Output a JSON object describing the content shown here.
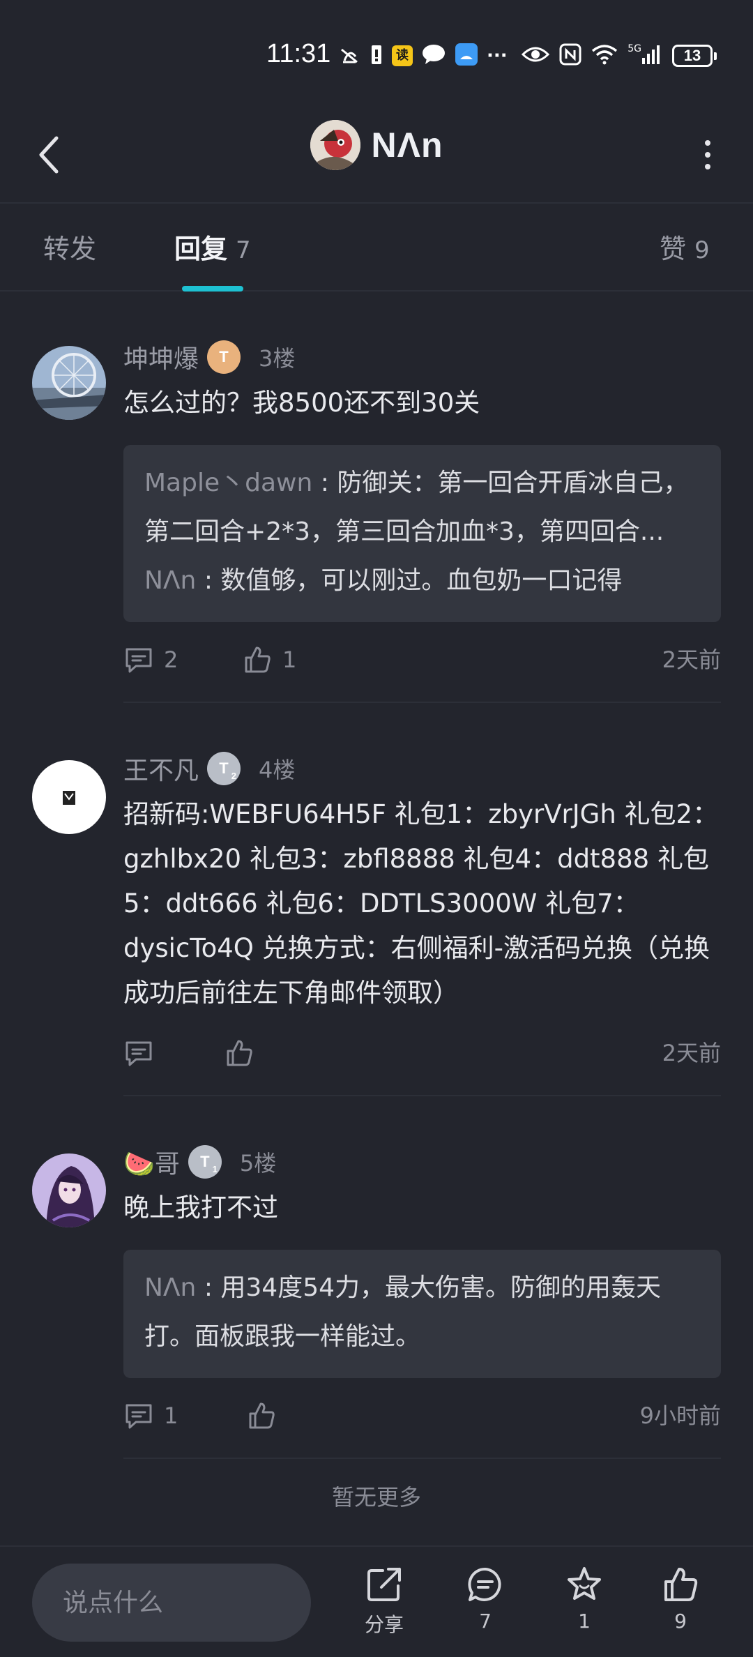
{
  "status_bar": {
    "time": "11:31",
    "badge_read": "读",
    "more_icons": "···",
    "network": "5G",
    "battery": "13"
  },
  "header": {
    "title": "NΛn"
  },
  "tabs": [
    {
      "label": "转发",
      "count": ""
    },
    {
      "label": "回复",
      "count": "7"
    },
    {
      "label": "赞",
      "count": "9"
    }
  ],
  "comments": [
    {
      "user": "坤坤爆",
      "level": "T",
      "floor": "3楼",
      "text": "怎么过的？我8500还不到30关",
      "quotes": [
        {
          "name": "Maple丶dawn",
          "text": "防御关：第一回合开盾冰自己，第二回合+2*3，第三回合加血*3，第四回合..."
        },
        {
          "name": "NΛn",
          "text": "数值够，可以刚过。血包奶一口记得"
        }
      ],
      "reply_count": "2",
      "like_count": "1",
      "time": "2天前"
    },
    {
      "user": "王不凡",
      "level": "T",
      "level_sub": "2",
      "floor": "4楼",
      "text": "招新码:WEBFU64H5F 礼包1：zbyrVrJGh 礼包2：gzhlbx20 礼包3：zbfl8888 礼包4：ddt888 礼包5：ddt666 礼包6：DDTLS3000W 礼包7：dysicTo4Q 兑换方式：右侧福利-激活码兑换（兑换成功后前往左下角邮件领取）",
      "quotes": [],
      "reply_count": "",
      "like_count": "",
      "time": "2天前"
    },
    {
      "user": "🍉哥",
      "level": "T",
      "level_sub": "1",
      "floor": "5楼",
      "text": "晚上我打不过",
      "quotes": [
        {
          "name": "NΛn",
          "text": "用34度54力，最大伤害。防御的用轰天打。面板跟我一样能过。"
        }
      ],
      "reply_count": "1",
      "like_count": "",
      "time": "9小时前"
    }
  ],
  "footer_note": "暂无更多",
  "bottom_bar": {
    "input_placeholder": "说点什么",
    "share_label": "分享",
    "comment_count": "7",
    "fav_count": "1",
    "like_count": "9"
  },
  "colors": {
    "background": "#23252d",
    "accent": "#1ec1d2",
    "quote_bg": "#33363f"
  }
}
